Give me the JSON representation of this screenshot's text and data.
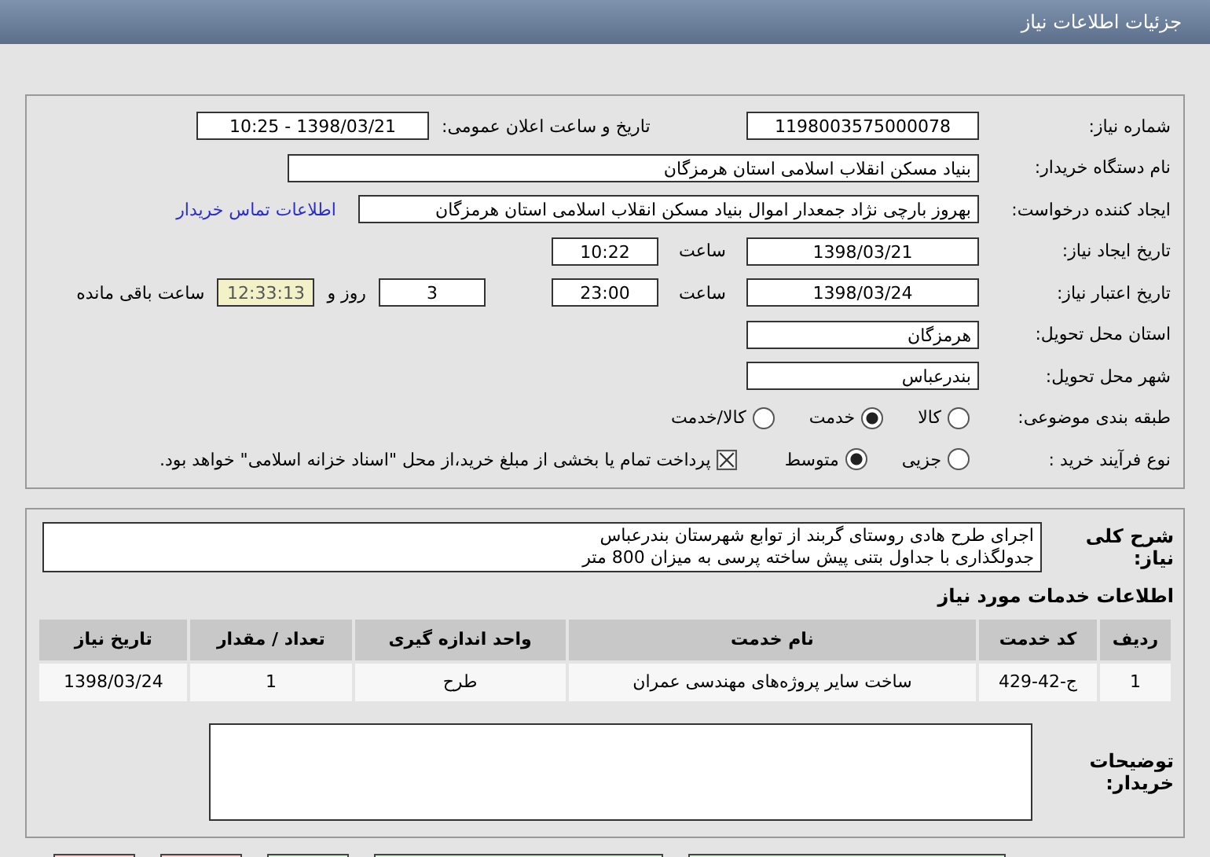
{
  "header": {
    "title": "جزئیات اطلاعات نیاز"
  },
  "need_number": {
    "label": "شماره نیاز:",
    "value": "1198003575000078"
  },
  "announce": {
    "label": "تاریخ و ساعت اعلان عمومی:",
    "value": "1398/03/21 - 10:25"
  },
  "buyer_org": {
    "label": "نام دستگاه خریدار:",
    "value": "بنیاد مسکن انقلاب اسلامی استان هرمزگان"
  },
  "creator": {
    "label": "ایجاد کننده درخواست:",
    "value": "بهروز  بارچی نژاد جمعدار اموال بنیاد مسکن انقلاب اسلامی استان هرمزگان",
    "link": "اطلاعات تماس خریدار"
  },
  "created": {
    "label": "تاریخ ایجاد نیاز:",
    "date": "1398/03/21",
    "time_label": "ساعت",
    "time": "10:22"
  },
  "validity": {
    "label": "تاریخ اعتبار نیاز:",
    "date": "1398/03/24",
    "time_label": "ساعت",
    "time": "23:00",
    "days": "3",
    "days_label": "روز و",
    "remaining": "12:33:13",
    "remaining_label": "ساعت باقی مانده"
  },
  "province": {
    "label": "استان محل تحویل:",
    "value": "هرمزگان"
  },
  "city": {
    "label": "شهر محل تحویل:",
    "value": "بندرعباس"
  },
  "category": {
    "label": "طبقه بندی موضوعی:",
    "options": [
      {
        "label": "کالا",
        "selected": false
      },
      {
        "label": "خدمت",
        "selected": true
      },
      {
        "label": "کالا/خدمت",
        "selected": false
      }
    ]
  },
  "process": {
    "label": "نوع فرآیند خرید :",
    "options": [
      {
        "label": "جزیی",
        "selected": false
      },
      {
        "label": "متوسط",
        "selected": true
      }
    ],
    "treasury": {
      "checked": true,
      "label": "پرداخت تمام یا بخشی از مبلغ خرید،از محل \"اسناد خزانه اسلامی\" خواهد بود."
    }
  },
  "description": {
    "label": "شرح کلی نیاز:",
    "lines": [
      "اجرای  طرح هادی روستای گربند  از توابع شهرستان بندرعباس",
      "جدولگذاری با جداول بتنی پیش ساخته پرسی به میزان 800 متر"
    ]
  },
  "services": {
    "title": "اطلاعات خدمات مورد نیاز",
    "columns": [
      "ردیف",
      "کد خدمت",
      "نام خدمت",
      "واحد اندازه گیری",
      "تعداد / مقدار",
      "تاریخ نیاز"
    ],
    "rows": [
      [
        "1",
        "ج-42-429",
        "ساخت سایر پروژه‌های مهندسی عمران",
        "طرح",
        "1",
        "1398/03/24"
      ]
    ]
  },
  "buyer_notes": {
    "label": "توضیحات خریدار:"
  },
  "buttons": [
    {
      "kind": "green"
    },
    {
      "kind": "green"
    },
    {
      "kind": "green"
    },
    {
      "kind": "red"
    },
    {
      "kind": "red"
    }
  ]
}
